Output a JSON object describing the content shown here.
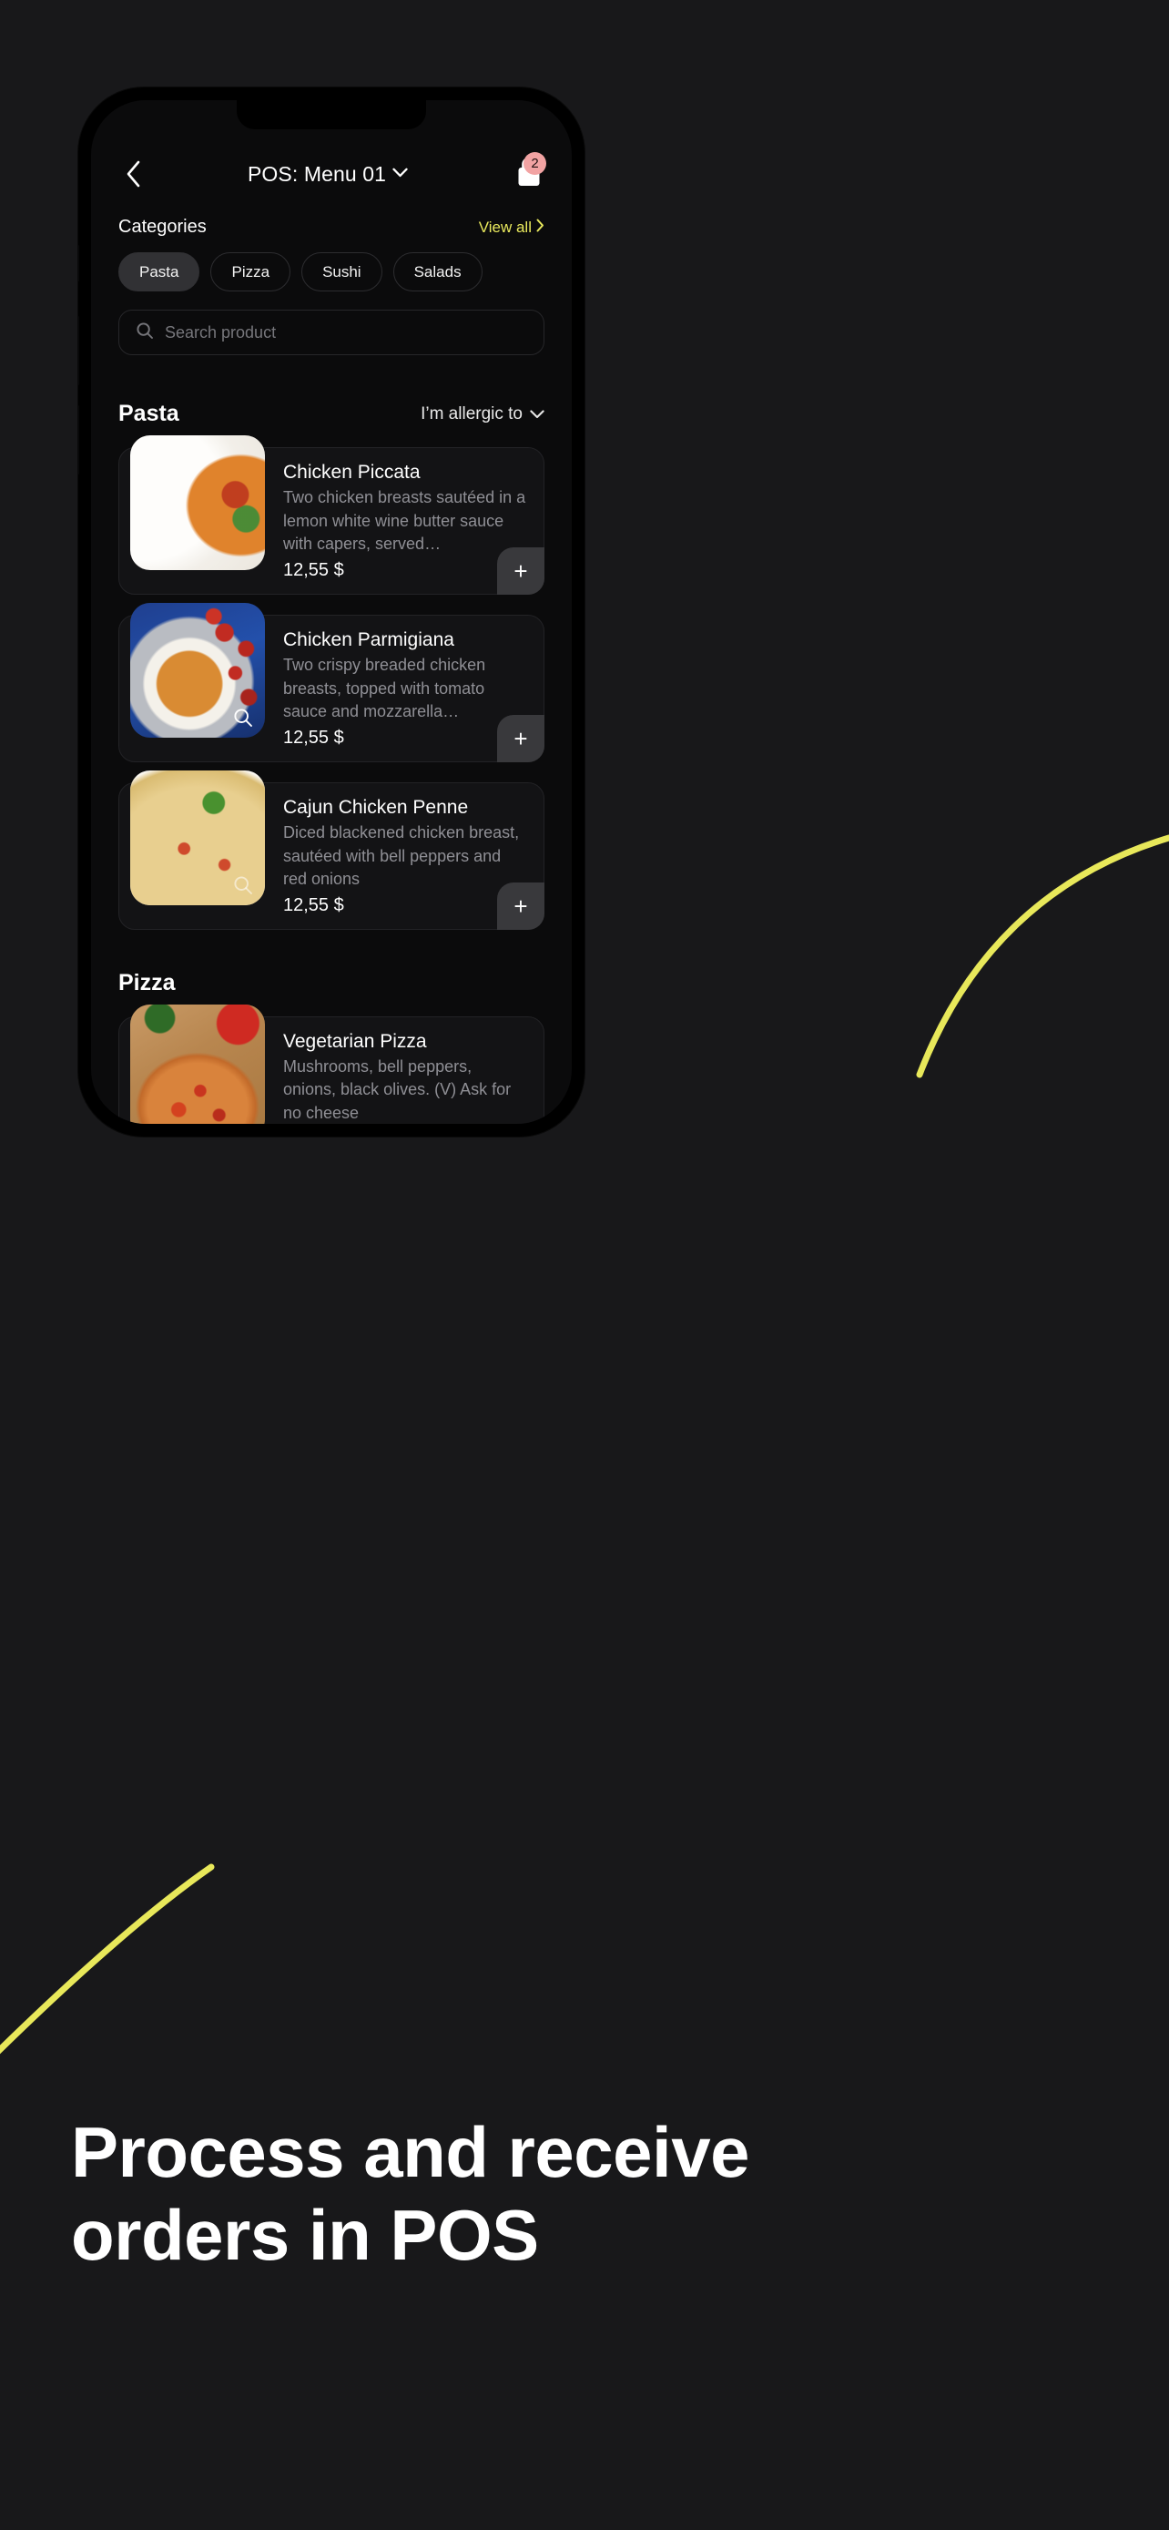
{
  "header": {
    "back_icon": "chevron-left-icon",
    "title": "POS: Menu 01",
    "title_chevron": "chevron-down-icon",
    "cart_icon": "shopping-bag-icon",
    "cart_count": "2",
    "cart_badge_color": "#f2a3a3"
  },
  "categories": {
    "label": "Categories",
    "view_all": "View all",
    "view_all_chevron": "chevron-right-icon",
    "accent_color": "#e9e95d",
    "chips": [
      {
        "label": "Pasta",
        "selected": true
      },
      {
        "label": "Pizza",
        "selected": false
      },
      {
        "label": "Sushi",
        "selected": false
      },
      {
        "label": "Salads",
        "selected": false
      }
    ]
  },
  "search": {
    "icon": "search-icon",
    "placeholder": "Search product",
    "value": ""
  },
  "menu": {
    "sections": [
      {
        "title": "Pasta",
        "filter_label": "I’m allergic to",
        "filter_chevron": "chevron-down-icon",
        "items": [
          {
            "name": "Chicken Piccata",
            "description": "Two chicken breasts sautéed in a lemon white wine butter sauce with capers, served…",
            "price": "12,55 $",
            "add_label": "+",
            "has_zoom_badge": false
          },
          {
            "name": "Chicken Parmigiana",
            "description": "Two crispy breaded chicken breasts, topped with tomato sauce and mozzarella…",
            "price": "12,55 $",
            "add_label": "+",
            "has_zoom_badge": true
          },
          {
            "name": "Cajun Chicken Penne",
            "description": "Diced blackened chicken breast, sautéed with bell peppers and red onions",
            "price": "12,55 $",
            "add_label": "+",
            "has_zoom_badge": true
          }
        ]
      },
      {
        "title": "Pizza",
        "items": [
          {
            "name": "Vegetarian Pizza",
            "description": "Mushrooms, bell peppers, onions, black olives. (V) Ask for no cheese",
            "price": "",
            "add_label": "+",
            "has_zoom_badge": false
          }
        ]
      }
    ]
  },
  "caption": {
    "line1": "Process and receive",
    "line2": "orders in POS"
  },
  "decor": {
    "arc_color": "#e8e85a"
  }
}
